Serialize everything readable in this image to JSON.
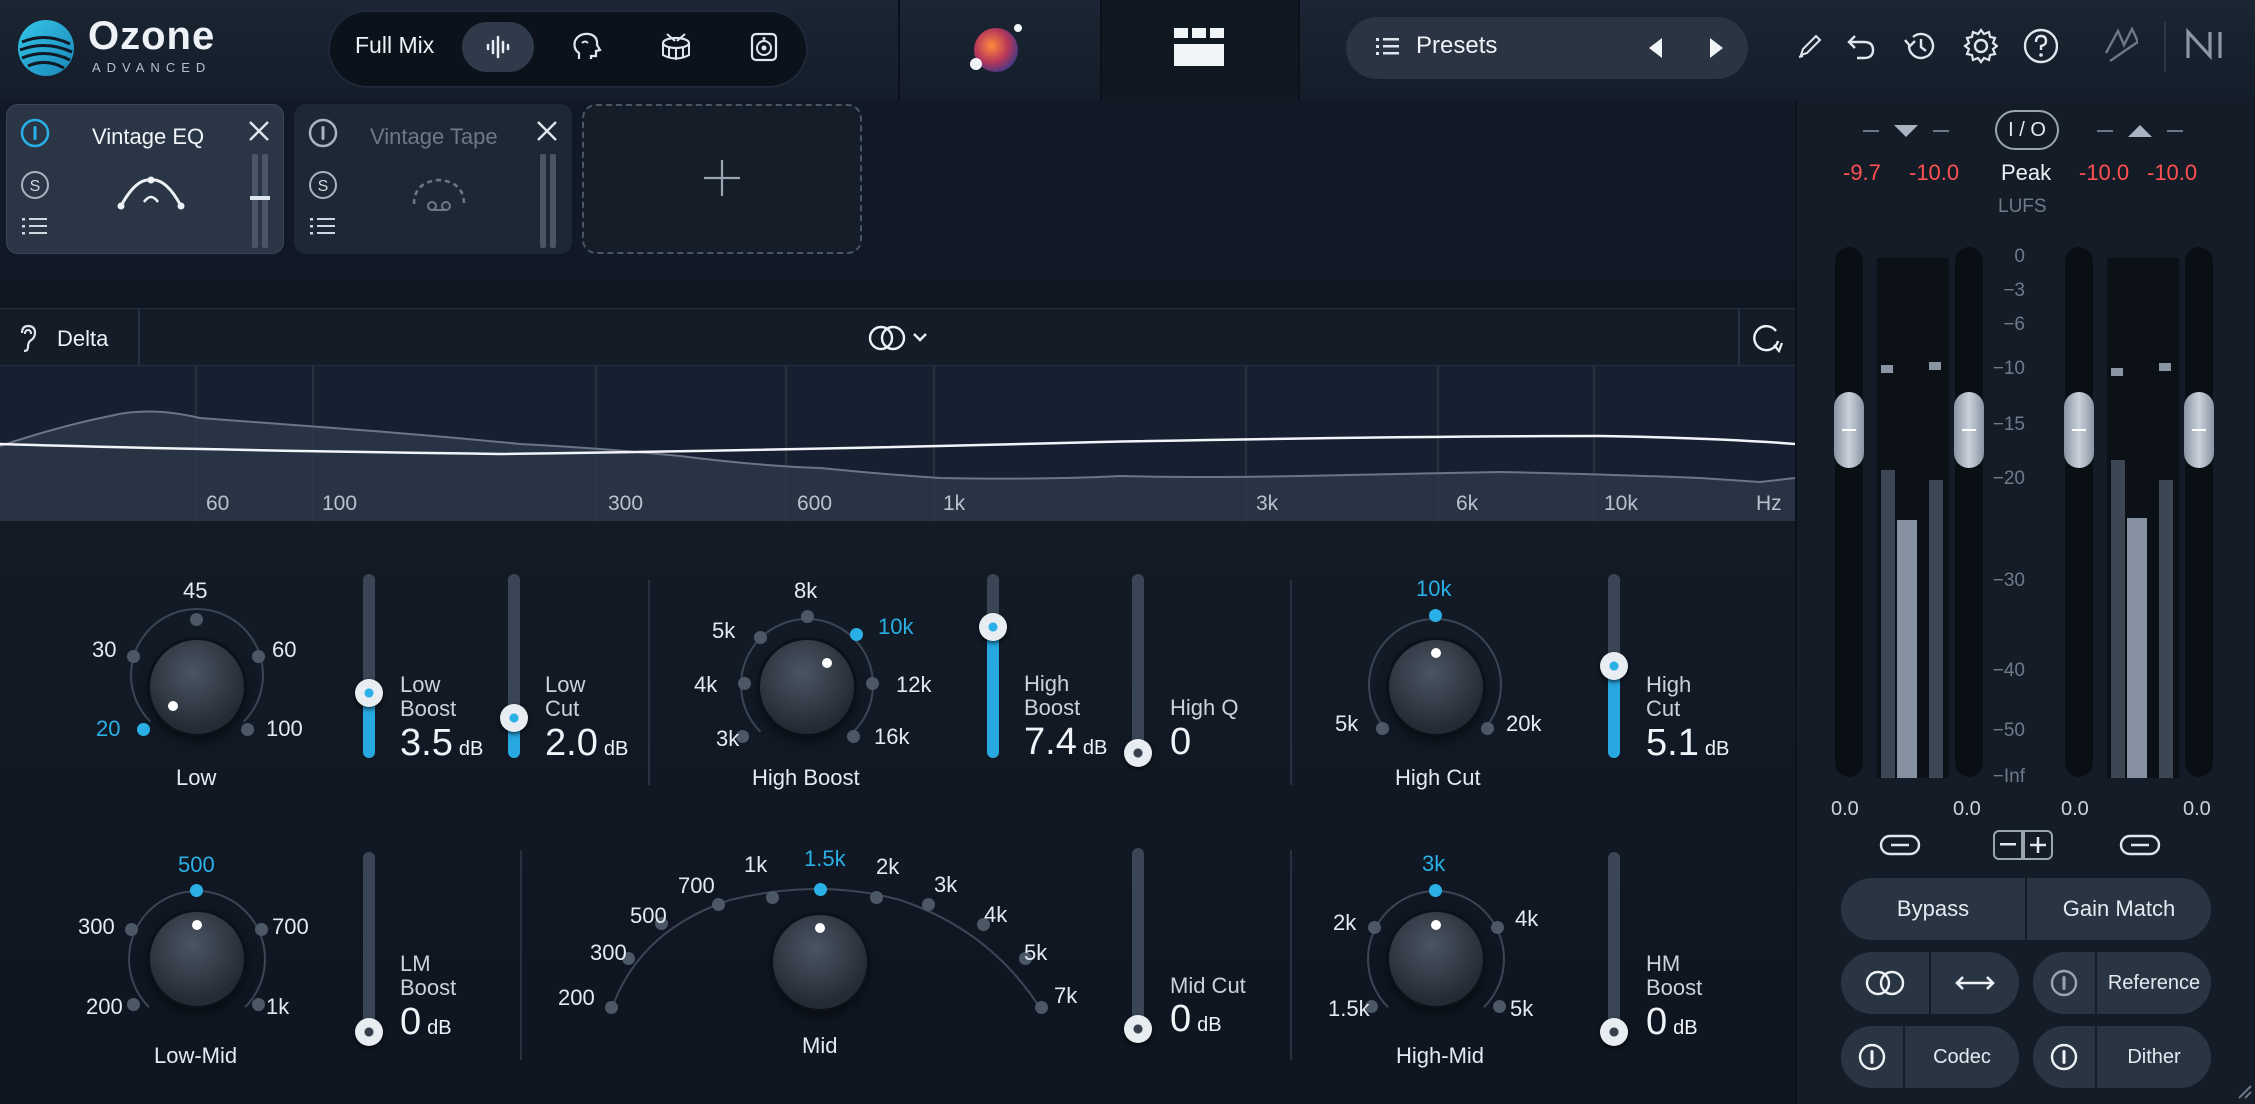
{
  "header": {
    "brand": "Ozone",
    "edition": "ADVANCED",
    "assistant_label": "Full Mix",
    "assistant_modes": [
      "waveform-icon",
      "vocal-head-icon",
      "drum-icon",
      "speaker-icon"
    ],
    "presets_label": "Presets",
    "icons": [
      "pencil-icon",
      "undo-icon",
      "history-icon",
      "gear-icon",
      "help-icon",
      "ni-fx-icon",
      "ni-logo-icon"
    ]
  },
  "modules": [
    {
      "title": "Vintage EQ",
      "active": true
    },
    {
      "title": "Vintage Tape",
      "active": false
    }
  ],
  "delta": {
    "label": "Delta"
  },
  "spectrum": {
    "freq_labels": [
      "60",
      "100",
      "300",
      "600",
      "1k",
      "3k",
      "6k",
      "10k",
      "Hz"
    ]
  },
  "low": {
    "name": "Low",
    "options": [
      "20",
      "30",
      "45",
      "60",
      "100"
    ],
    "selected": "20",
    "boost_label1": "Low",
    "boost_label2": "Boost",
    "boost_value": "3.5",
    "boost_unit": "dB",
    "boost_level": 0.27,
    "cut_label1": "Low",
    "cut_label2": "Cut",
    "cut_value": "2.0",
    "cut_unit": "dB",
    "cut_level": 0.2
  },
  "high_boost": {
    "name": "High Boost",
    "options": [
      "3k",
      "4k",
      "5k",
      "8k",
      "10k",
      "12k",
      "16k"
    ],
    "selected": "10k",
    "boost_label1": "High",
    "boost_label2": "Boost",
    "boost_value": "7.4",
    "boost_unit": "dB",
    "boost_level": 0.74,
    "q_label": "High Q",
    "q_value": "0"
  },
  "high_cut": {
    "name": "High Cut",
    "options": [
      "5k",
      "10k",
      "20k"
    ],
    "selected": "10k",
    "cut_label1": "High",
    "cut_label2": "Cut",
    "cut_value": "5.1",
    "cut_unit": "dB",
    "cut_level": 0.51
  },
  "low_mid": {
    "name": "Low-Mid",
    "options": [
      "200",
      "300",
      "500",
      "700",
      "1k"
    ],
    "selected": "500",
    "boost_label1": "LM",
    "boost_label2": "Boost",
    "boost_value": "0",
    "boost_unit": "dB"
  },
  "mid": {
    "name": "Mid",
    "options": [
      "200",
      "300",
      "500",
      "700",
      "1k",
      "1.5k",
      "2k",
      "3k",
      "4k",
      "5k",
      "7k"
    ],
    "selected": "1.5k",
    "cut_label": "Mid Cut",
    "cut_value": "0",
    "cut_unit": "dB"
  },
  "high_mid": {
    "name": "High-Mid",
    "options": [
      "1.5k",
      "2k",
      "3k",
      "4k",
      "5k"
    ],
    "selected": "3k",
    "boost_label1": "HM",
    "boost_label2": "Boost",
    "boost_value": "0",
    "boost_unit": "dB"
  },
  "meters": {
    "io_label": "I / O",
    "in_left": "-9.7",
    "in_right": "-10.0",
    "out_left": "-10.0",
    "out_right": "-10.0",
    "mode": "Peak",
    "unit": "LUFS",
    "scale": [
      "0",
      "−3",
      "−6",
      "−10",
      "−15",
      "−20",
      "−30",
      "−40",
      "−50",
      "−Inf"
    ],
    "gain_values": [
      "0.0",
      "0.0",
      "0.0",
      "0.0"
    ],
    "buttons": {
      "bypass": "Bypass",
      "gain_match": "Gain Match",
      "reference": "Reference",
      "codec": "Codec",
      "dither": "Dither"
    }
  },
  "colors": {
    "accent": "#2ab0e6",
    "peak_red": "#ff5151"
  }
}
